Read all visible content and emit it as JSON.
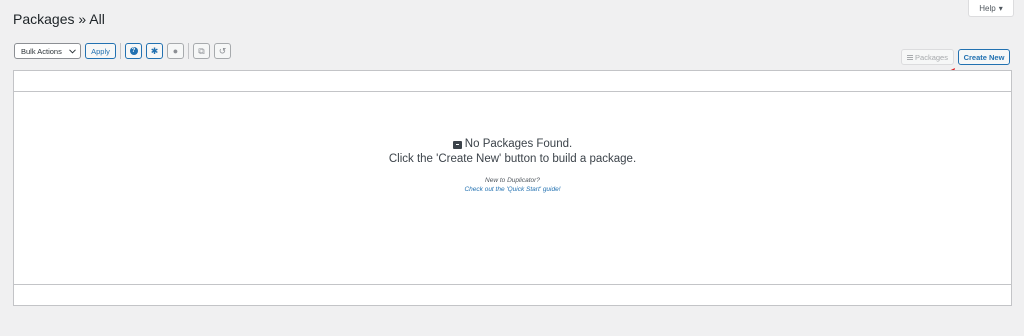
{
  "page": {
    "title": "Packages » All",
    "help_label": "Help"
  },
  "toolbar": {
    "bulk_actions": {
      "selected": "Bulk Actions"
    },
    "apply_label": "Apply"
  },
  "actions": {
    "packages_label": "Packages",
    "create_new_label": "Create New"
  },
  "empty_state": {
    "title": "No Packages Found.",
    "subtitle": "Click the 'Create New' button to build a package.",
    "new_to": "New to Duplicator?",
    "guide_link": "Check out the 'Quick Start' guide!"
  },
  "icons": {
    "help": "?",
    "settings": "✱",
    "info": "●",
    "copy": "⧉",
    "refresh": "↺",
    "dropdown": "▾"
  },
  "colors": {
    "accent": "#2271b1",
    "annotation_arrow": "#e02020",
    "background": "#f0f0f1"
  }
}
